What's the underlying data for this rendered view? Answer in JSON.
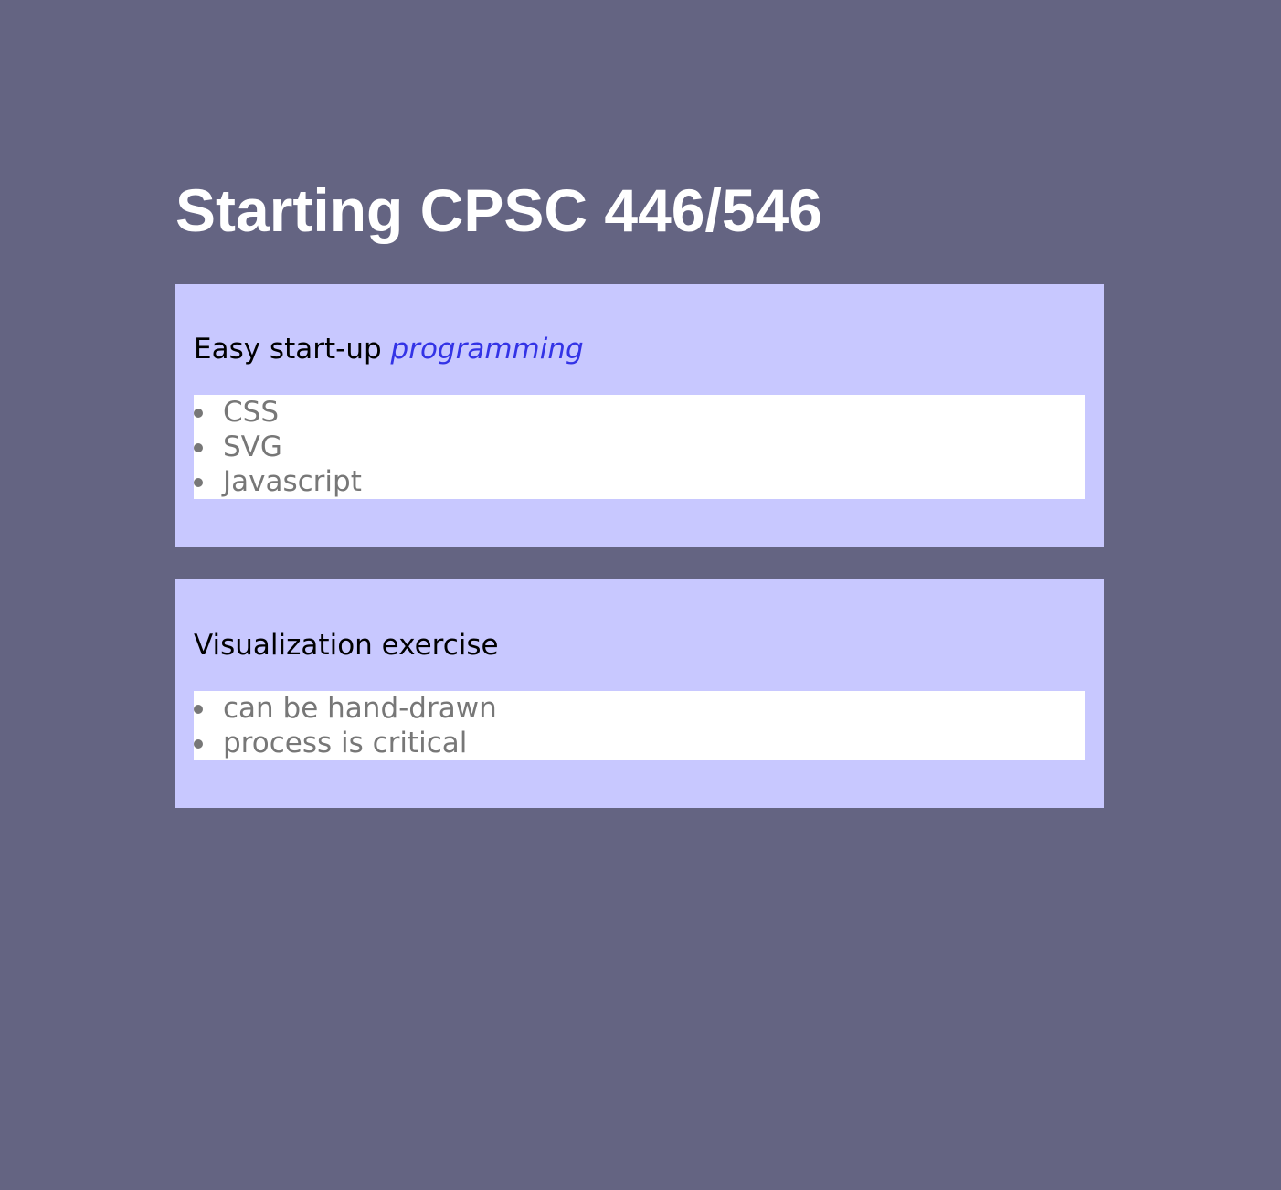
{
  "page": {
    "title": "Starting CPSC 446/546"
  },
  "cards": [
    {
      "heading": "Easy start-up",
      "heading_accent": "programming",
      "items": [
        "CSS",
        "SVG",
        "Javascript"
      ]
    },
    {
      "heading": "Visualization exercise",
      "items": [
        "can be hand-drawn",
        "process is critical"
      ]
    }
  ],
  "colors": {
    "background": "#646482",
    "card_background": "#c8c8ff",
    "list_background": "#ffffff",
    "list_text": "#777777",
    "accent": "#3333e6"
  }
}
